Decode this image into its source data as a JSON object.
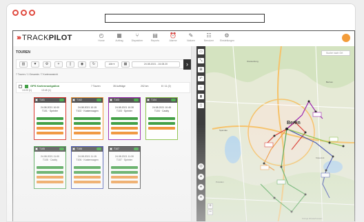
{
  "logo": {
    "prefix": "›››",
    "track": "TRACK",
    "pilot": "PILOT"
  },
  "nav": [
    {
      "icon": "◴",
      "label": "Home"
    },
    {
      "icon": "▦",
      "label": "Auftrag"
    },
    {
      "icon": "⑂",
      "label": "Dispatcher"
    },
    {
      "icon": "▤",
      "label": "Reports"
    },
    {
      "icon": "⏰",
      "label": "Alarme"
    },
    {
      "icon": "✎",
      "label": "Notizen"
    },
    {
      "icon": "☷",
      "label": "Benutzer"
    },
    {
      "icon": "⚙",
      "label": "Einstellungen"
    }
  ],
  "section_title": "TOUREN",
  "toolbar": {
    "buttons": [
      "▥",
      "▼",
      "⚙",
      "+",
      "▯",
      "◉",
      "↻"
    ],
    "select_label": "Alle ▾",
    "calendar_icon": "▦",
    "date_range": "24.08.2021 - 24.08.20",
    "next": "›"
  },
  "breadcrumb": "7 Touren / 1 Gesamte / 7 Kartenansicht",
  "group": {
    "name": "GPS Kartennavigation",
    "sub_left": "13:20 (1)",
    "sub_right": "13:45 (1)",
    "stats": [
      "7 Touren",
      "35 Aufträge",
      "202 km",
      "8 / 11 (2)"
    ]
  },
  "cards": [
    {
      "color": "#d9352b",
      "title": "T101",
      "line1": "24.08.2021 10:00",
      "line2": "T101 · Sprinter",
      "bars": [
        "green",
        "green",
        "orange",
        "orange"
      ]
    },
    {
      "color": "#f0953a",
      "title": "T102",
      "line1": "24.08.2021 10:15",
      "line2": "T102 · Kastenwagen",
      "bars": [
        "green",
        "green",
        "orange",
        "orange"
      ]
    },
    {
      "color": "#9c27b0",
      "title": "T103",
      "line1": "24.08.2021 10:30",
      "line2": "T103 · Sprinter",
      "bars": [
        "green",
        "green",
        "orange",
        "orange"
      ]
    },
    {
      "color": "#8bc34a",
      "title": "T104",
      "line1": "24.08.2021 10:45",
      "line2": "T104 · Caddy",
      "bars": [
        "green",
        "green",
        "orange"
      ]
    },
    {
      "color": "#43a047",
      "title": "T105",
      "line1": "24.08.2021 11:00",
      "line2": "T105 · Caddy",
      "bars": [
        "green",
        "green",
        "orange",
        "orange"
      ]
    },
    {
      "color": "#3949ab",
      "title": "T106",
      "line1": "24.08.2021 11:15",
      "line2": "T106 · Kastenwagen",
      "bars": [
        "green",
        "green",
        "orange",
        "orange"
      ]
    },
    {
      "color": "#333333",
      "title": "T107",
      "line1": "24.08.2021 11:30",
      "line2": "T107 · Sprinter",
      "bars": [
        "green",
        "green",
        "orange",
        "orange"
      ]
    }
  ],
  "map": {
    "search_placeholder": "Suche nach Ort",
    "city": "Berlin",
    "places": [
      "Potsdam",
      "Oranienburg",
      "Bernau",
      "Spandau",
      "Köpenick",
      "Königs Wusterhausen"
    ],
    "zoom_in": "+",
    "zoom_out": "−"
  },
  "map_tools": [
    "▭",
    "⤡",
    "⊞",
    "↶",
    "⌂",
    "▮",
    "▯"
  ],
  "map_tools_round": [
    "◎",
    "●",
    "●",
    "●"
  ]
}
